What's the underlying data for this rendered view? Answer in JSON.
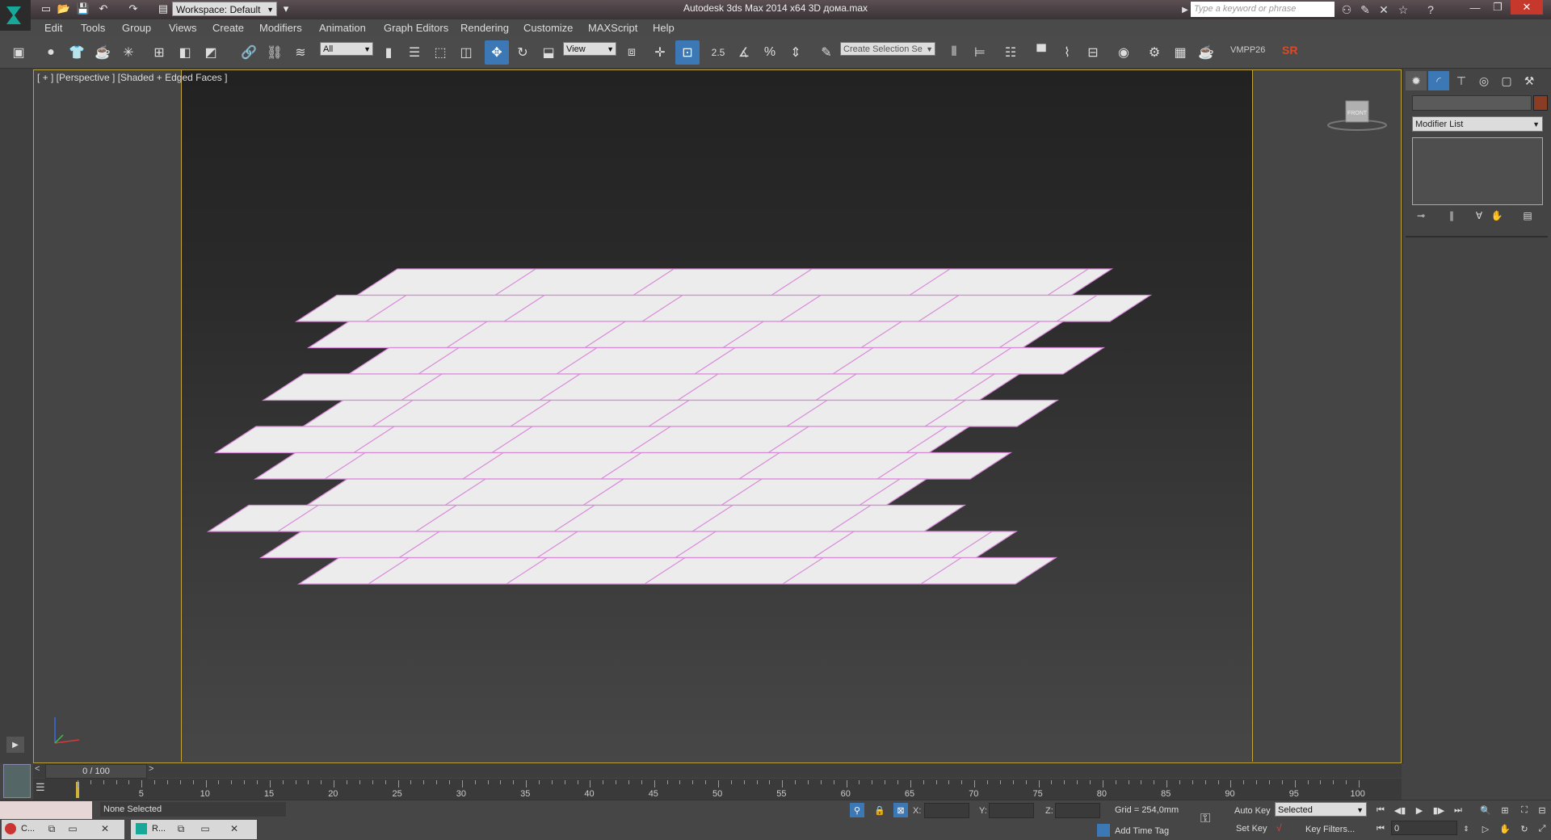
{
  "titlebar": {
    "workspace": "Workspace: Default",
    "title": "Autodesk 3ds Max  2014 x64      3D дома.max",
    "search_placeholder": "Type a keyword or phrase"
  },
  "menu": [
    "Edit",
    "Tools",
    "Group",
    "Views",
    "Create",
    "Modifiers",
    "Animation",
    "Graph Editors",
    "Rendering",
    "Customize",
    "MAXScript",
    "Help"
  ],
  "toolbar": {
    "filter_value": "All",
    "ref_coord_value": "View",
    "snap_label": "2.5",
    "selection_set_placeholder": "Create Selection Se",
    "plugin1": "VMPP26",
    "plugin2": "SR",
    "accent_active": "#3c78b5",
    "plugin2_color": "#d94a2a"
  },
  "viewport": {
    "label": "[ + ] [Perspective ] [Shaded + Edged Faces ]",
    "border_color": "#c4a63a",
    "viewcube_face": "FRONT",
    "tile_color": "#ececec",
    "edge_color": "#d98bd9"
  },
  "command_panel": {
    "modifier_list": "Modifier List"
  },
  "timeline": {
    "frame_display": "0 / 100",
    "ticks": [
      "5",
      "10",
      "15",
      "20",
      "25",
      "30",
      "35",
      "40",
      "45",
      "50",
      "55",
      "60",
      "65",
      "70",
      "75",
      "80",
      "85",
      "90",
      "95",
      "100"
    ]
  },
  "status": {
    "selection": "None Selected",
    "x_label": "X:",
    "y_label": "Y:",
    "z_label": "Z:",
    "grid": "Grid = 254,0mm",
    "add_time_tag": "Add Time Tag",
    "auto_key": "Auto Key",
    "set_key": "Set Key",
    "selected": "Selected",
    "key_filters": "Key Filters...",
    "frame": "0"
  },
  "taskbar": {
    "task1": "C...",
    "task2": "R..."
  }
}
